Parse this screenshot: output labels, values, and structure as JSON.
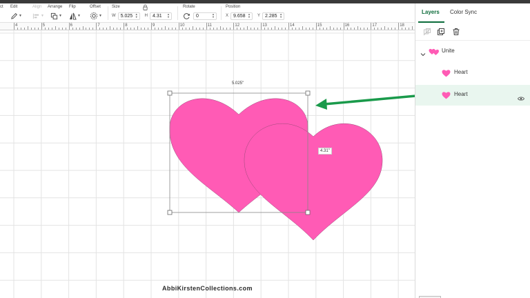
{
  "toolbar": {
    "edit_partial": "ct",
    "edit": "Edit",
    "align": "Align",
    "arrange": "Arrange",
    "flip": "Flip",
    "offset": "Offset",
    "size": "Size",
    "width_label": "W",
    "width_value": "5.025",
    "height_label": "H",
    "height_value": "4.31",
    "rotate": "Rotate",
    "rotate_value": "0",
    "position": "Position",
    "x_label": "X",
    "x_value": "9.658",
    "y_label": "Y",
    "y_value": "2.285"
  },
  "ruler": {
    "numbers": [
      "4",
      "5",
      "6",
      "7",
      "8",
      "9",
      "10",
      "11",
      "12",
      "13",
      "14",
      "15",
      "16",
      "17",
      "18"
    ]
  },
  "canvas": {
    "width_label": "5.025\"",
    "height_label": "4.31\"",
    "watermark": "AbbiKirstenCollections.com",
    "heart_color": "#ff5bb5",
    "arrow_color": "#1a9a4b"
  },
  "panel": {
    "tabs": [
      "Layers",
      "Color Sync"
    ],
    "active_tab": "Layers",
    "layers": {
      "group": "Unite",
      "items": [
        "Heart",
        "Heart"
      ]
    },
    "accent_color": "#0b6b3a",
    "selected_row_color": "#e9f6ef"
  }
}
